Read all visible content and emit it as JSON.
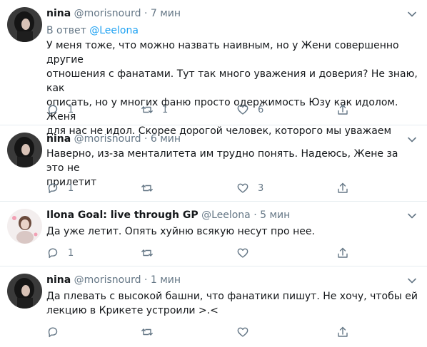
{
  "colors": {
    "link": "#1da1f2",
    "secondary": "#657786",
    "text": "#14171a",
    "divider": "#e6ecf0"
  },
  "tweets": [
    {
      "name": "nina",
      "handle": "@morisnourd",
      "dot": "·",
      "time": "7 мин",
      "reply_prefix": "В ответ",
      "reply_handle": "@Leelona",
      "text": "У меня тоже, что можно назвать наивным, но у Жени совершенно другие\nотношения с фанатами. Тут так много уважения и доверия? Не знаю, как\nописать, но у многих фаню просто одержимость Юзу как идолом. Женя\nдля нас не идол. Скорее дорогой человек, которого мы уважаем",
      "replies": "1",
      "retweets": "1",
      "likes": "6"
    },
    {
      "name": "nina",
      "handle": "@morisnourd",
      "dot": "·",
      "time": "6 мин",
      "text": "Наверно, из-за менталитета им трудно понять. Надеюсь, Жене за это не\nприлетит",
      "replies": "1",
      "retweets": "",
      "likes": "3"
    },
    {
      "name": "Ilona Goal: live through GP",
      "handle": "@Leelona",
      "dot": "·",
      "time": "5 мин",
      "text": "Да уже летит. Опять хуйню всякую несут про нее.",
      "replies": "1",
      "retweets": "",
      "likes": ""
    },
    {
      "name": "nina",
      "handle": "@morisnourd",
      "dot": "·",
      "time": "1 мин",
      "text": "Да плевать с высокой башни, что фанатики пишут. Не хочу, чтобы ей\nлекцию в Крикете устроили >.<",
      "replies": "",
      "retweets": "",
      "likes": ""
    }
  ]
}
